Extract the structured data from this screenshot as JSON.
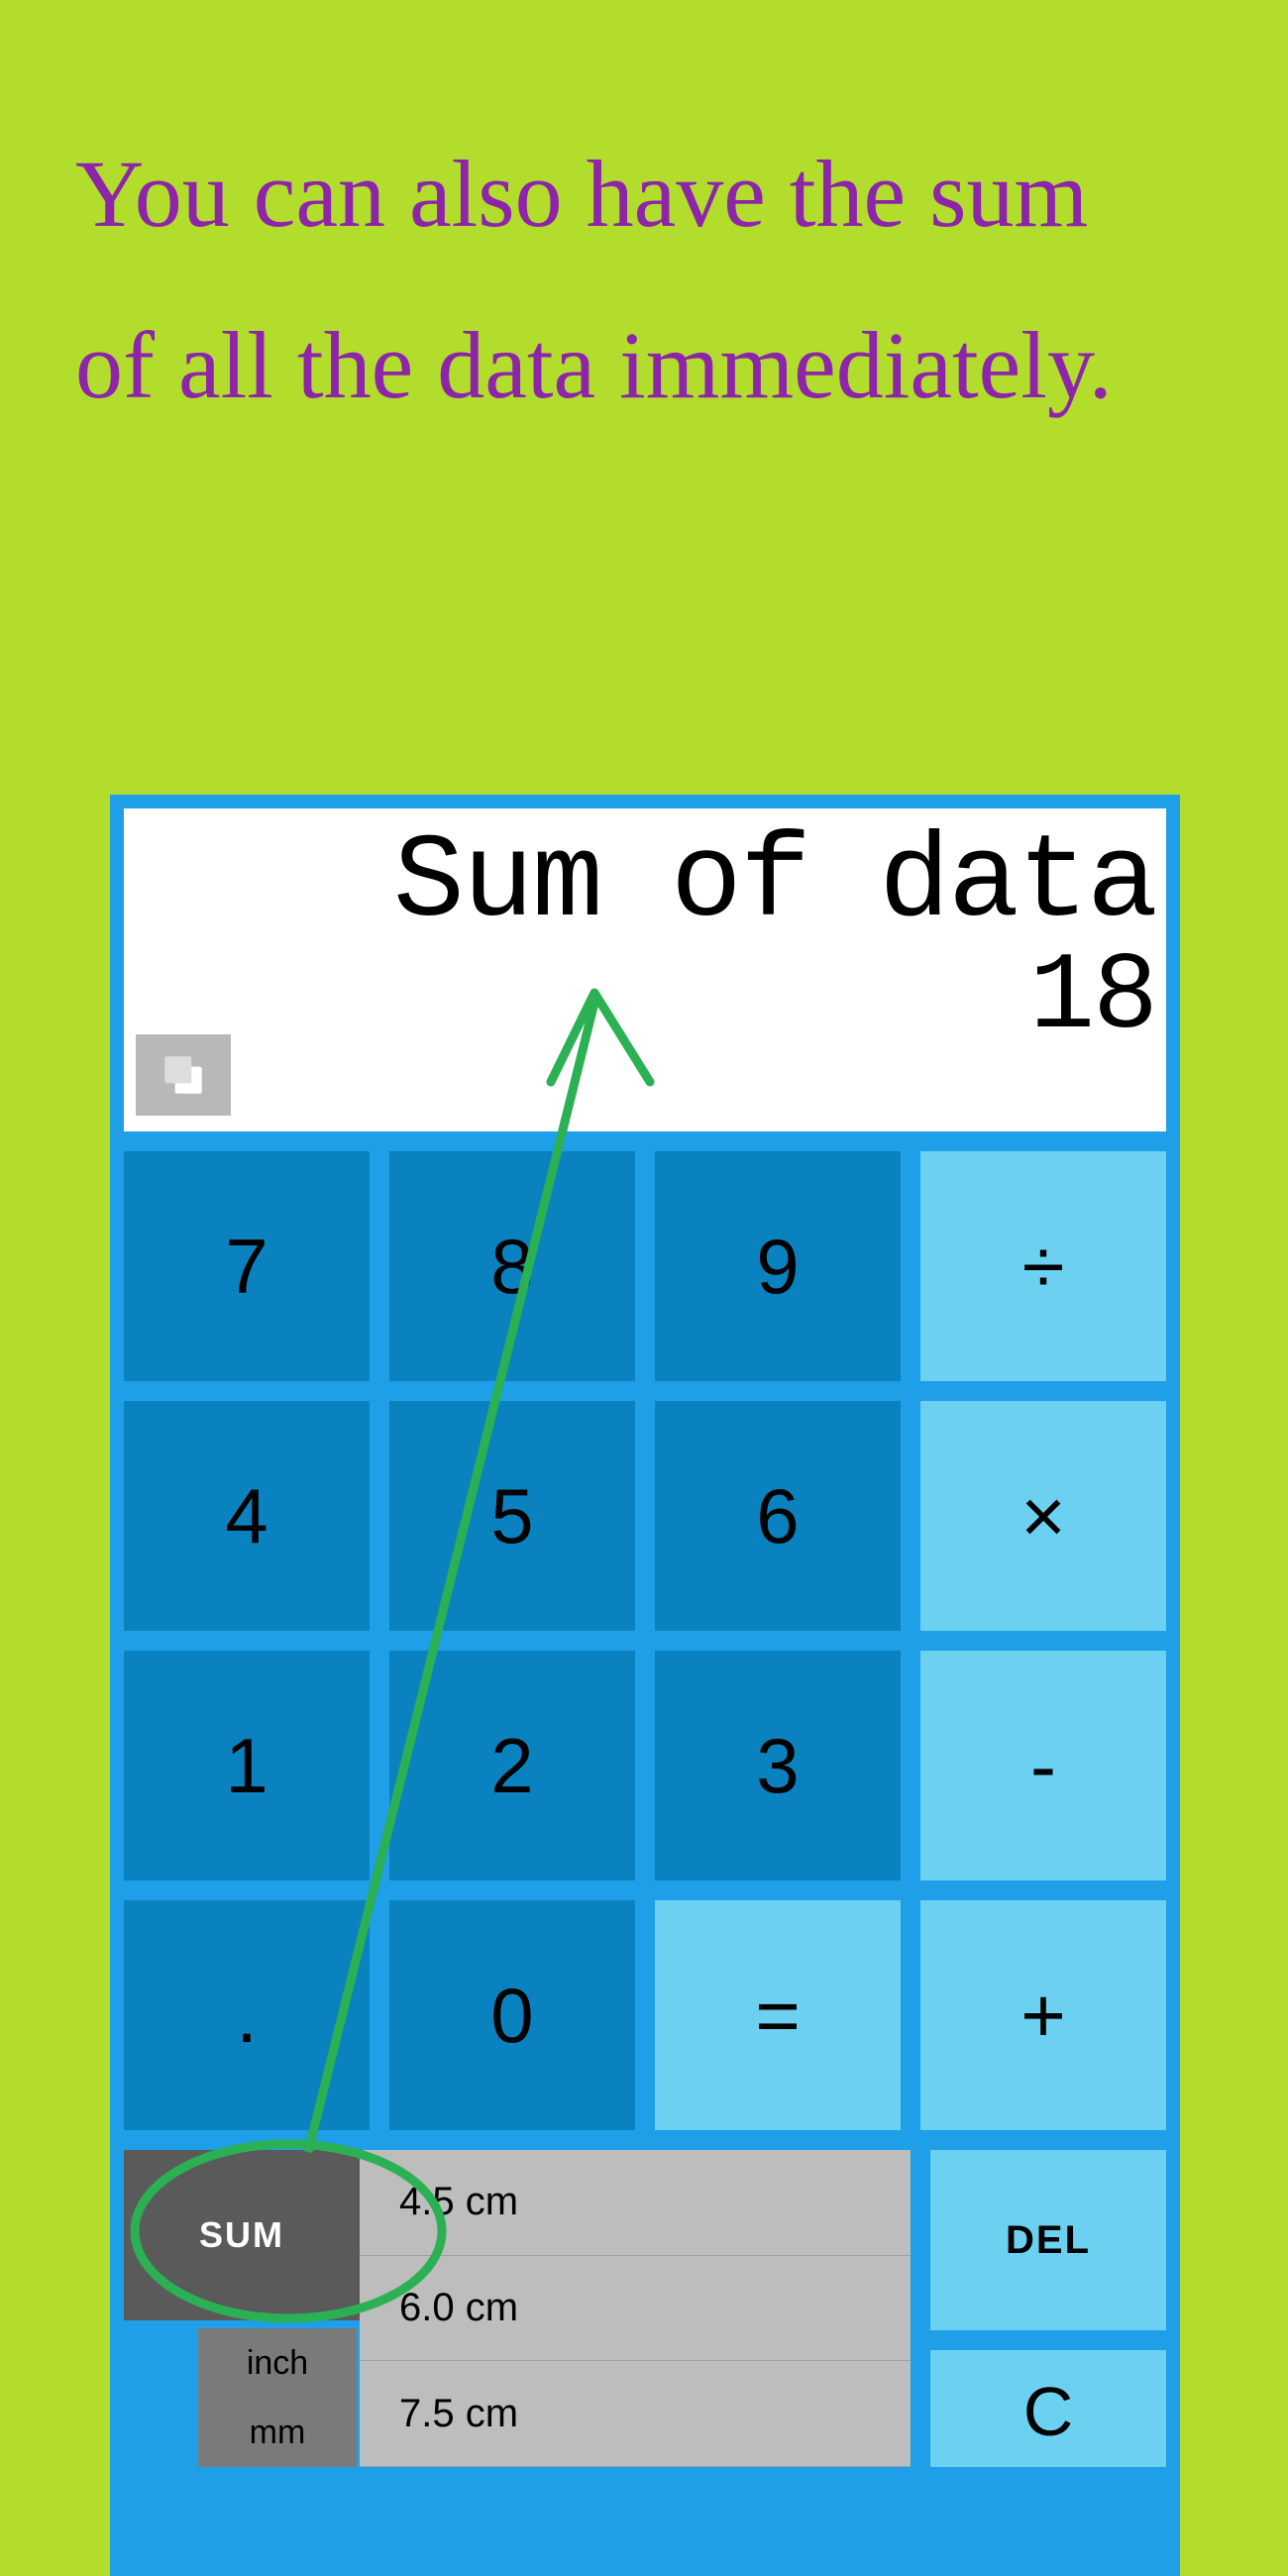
{
  "caption": "You can also have the sum of all the data immediately.",
  "display": {
    "line1": "Sum of data",
    "line2": "18"
  },
  "keypad": {
    "r1": {
      "k1": "7",
      "k2": "8",
      "k3": "9",
      "k4": "÷"
    },
    "r2": {
      "k1": "4",
      "k2": "5",
      "k3": "6",
      "k4": "×"
    },
    "r3": {
      "k1": "1",
      "k2": "2",
      "k3": "3",
      "k4": "-"
    },
    "r4": {
      "k1": ".",
      "k2": "0",
      "k3": "=",
      "k4": "+"
    }
  },
  "bottom": {
    "sum": "SUM",
    "units": {
      "u1": "inch",
      "u2": "mm"
    },
    "data_items": {
      "d1": "4.5 cm",
      "d2": "6.0 cm",
      "d3": "7.5 cm"
    },
    "del": "DEL",
    "clear": "C"
  }
}
